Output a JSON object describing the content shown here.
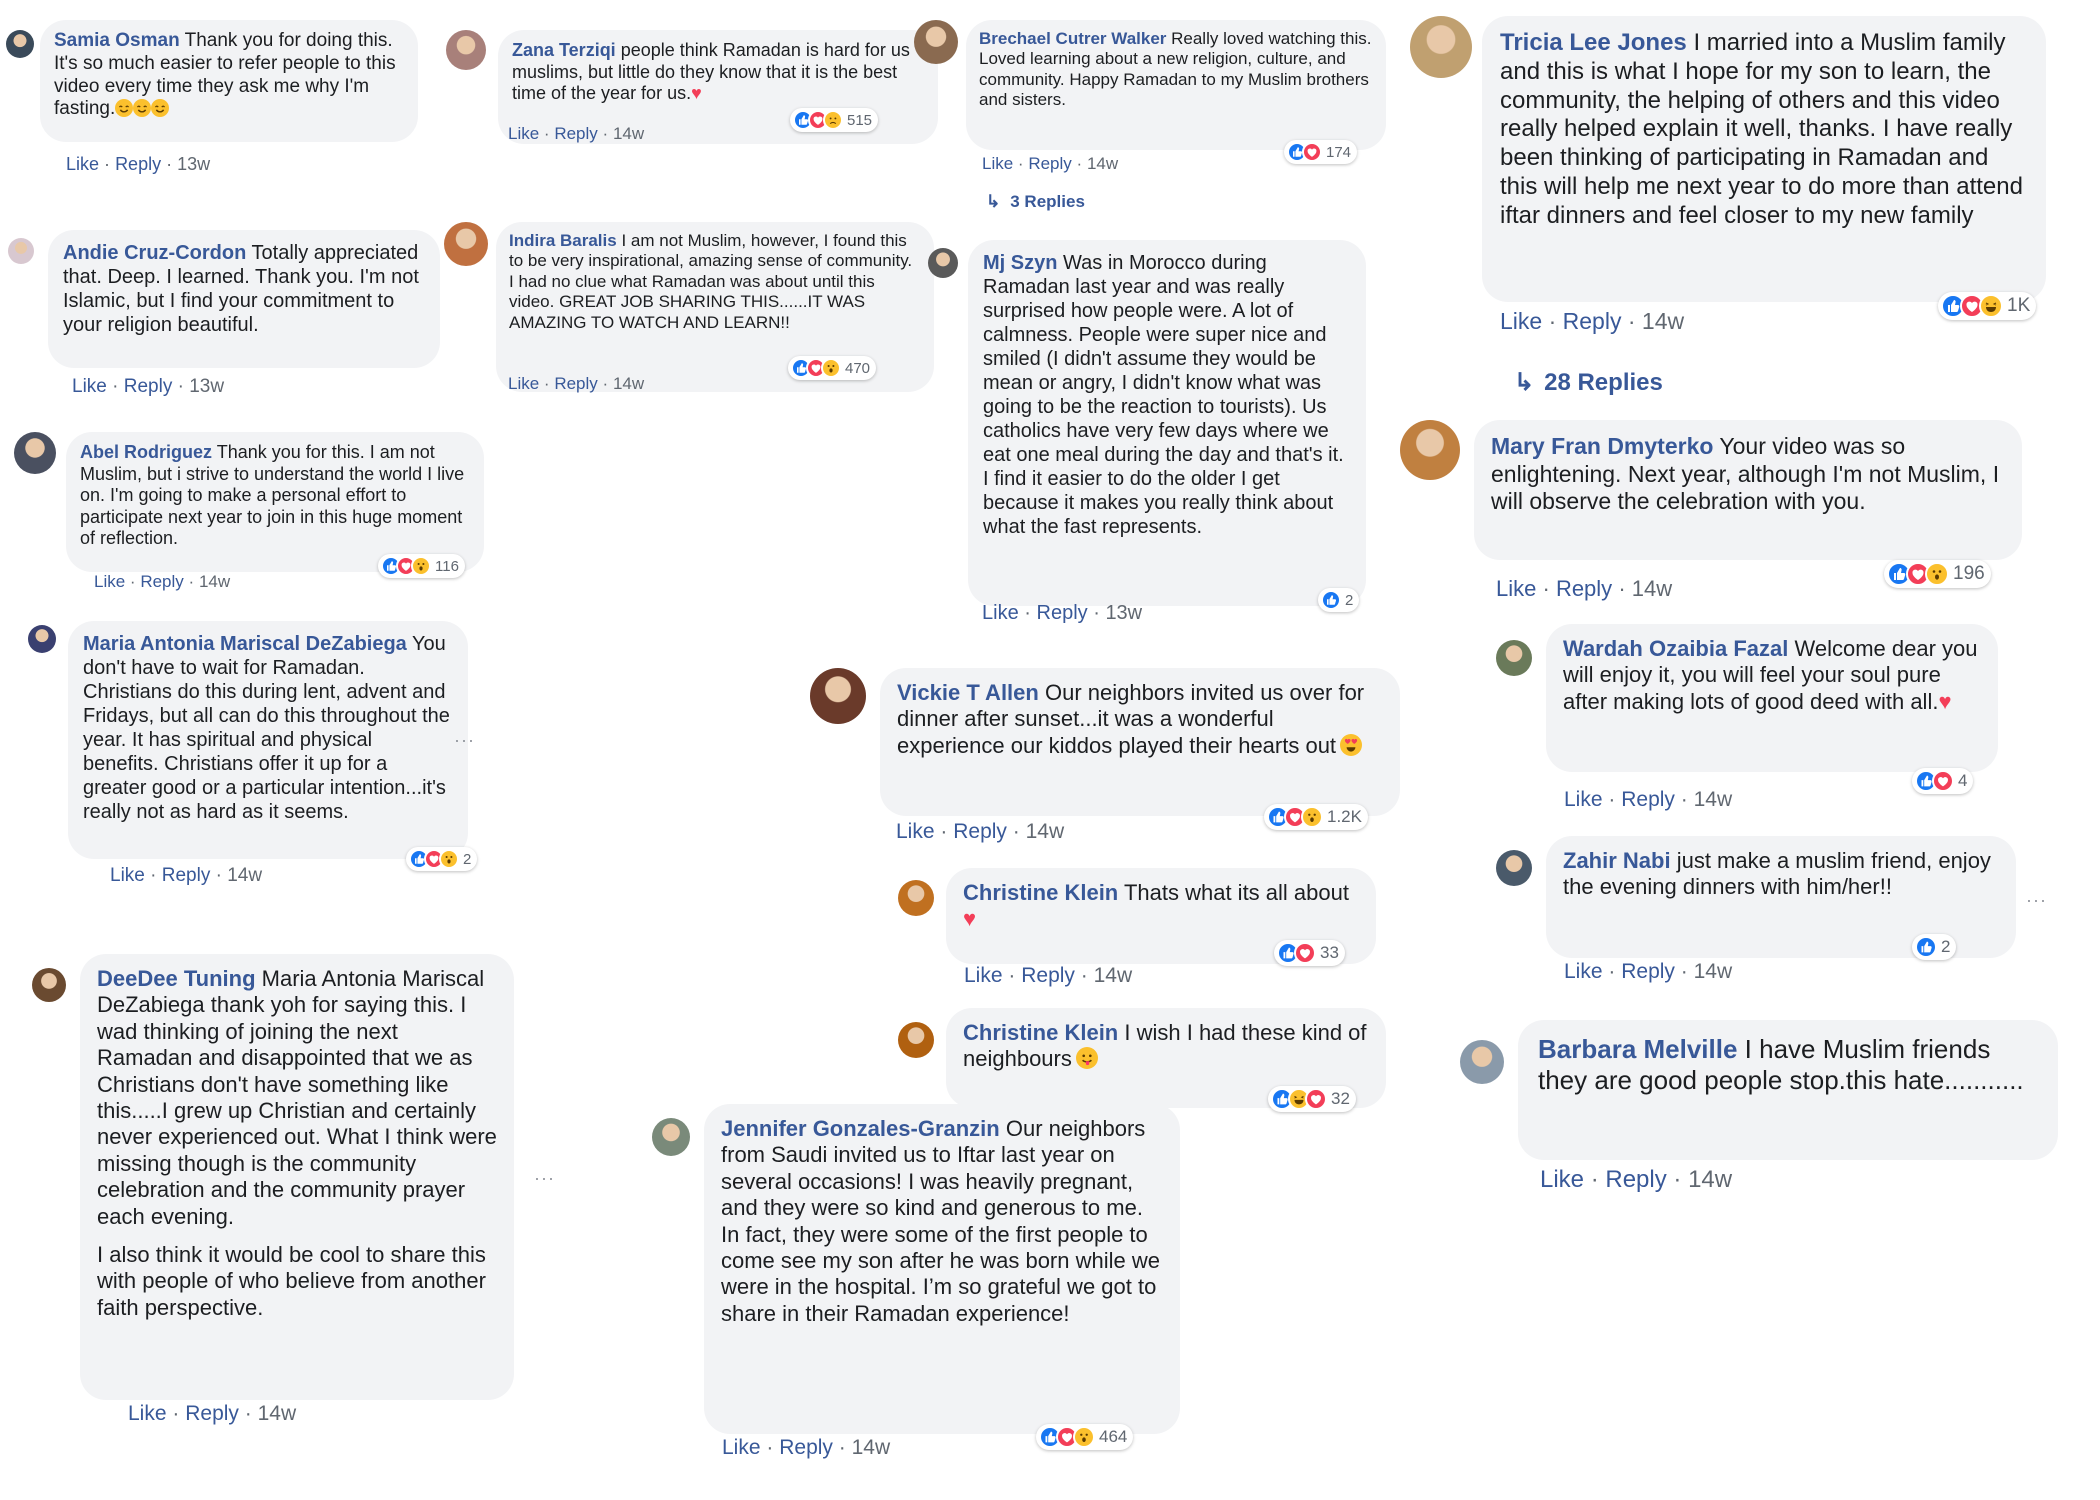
{
  "actions": {
    "like": "Like",
    "reply": "Reply",
    "sep": "·"
  },
  "colors": {
    "link": "#385898",
    "bubble": "#f2f3f5",
    "like": "#1877f2",
    "love": "#f33e58",
    "wow": "#fbc02d"
  },
  "comments": [
    {
      "author": "Samia Osman",
      "text": "Thank you for doing this. It's so much easier to refer people to this video every time they ask me why I'm fasting.",
      "emoji": "smile-emoji x3",
      "time": "13w"
    },
    {
      "author": "Andie Cruz-Cordon",
      "text": "Totally appreciated that. Deep. I learned. Thank you. I'm not Islamic, but I find your commitment to your religion beautiful.",
      "time": "13w"
    },
    {
      "author": "Abel Rodriguez",
      "text": "Thank you for this. I am not Muslim, but i strive to understand the world I live on. I'm going to make a personal effort to participate next year to join in this huge moment of reflection.",
      "time": "14w",
      "reactions": "116"
    },
    {
      "author": "Maria Antonia Mariscal DeZabiega",
      "text": "You don't have to wait for Ramadan. Christians do this during lent, advent and Fridays, but all can do this throughout the year. It has spiritual and physical benefits. Christians offer it up for a greater good or a particular intention...it's really not as hard as it seems.",
      "time": "14w",
      "reactions": "2"
    },
    {
      "author": "DeeDee Tuning",
      "text": "Maria Antonia Mariscal DeZabiega thank yoh for saying this. I wad thinking of joining the next Ramadan and disappointed that we as Christians don't have something like this.....I grew up Christian and certainly never experienced out. What I think were missing though is the community celebration and the community prayer each evening.",
      "text2": "I also think it would be cool to share this with people of who believe from another faith perspective.",
      "time": "14w"
    },
    {
      "author": "Zana Terziqi",
      "text": "people think Ramadan is hard for us muslims, but little do they know that it is the best time of the year for us.",
      "time": "14w",
      "reactions": "515"
    },
    {
      "author": "Indira Baralis",
      "text": "I am not Muslim, however, I found this to be very inspirational, amazing sense of community. I had no clue what Ramadan was about until this video. GREAT JOB SHARING THIS......IT WAS AMAZING TO WATCH AND LEARN!!",
      "time": "14w",
      "reactions": "470"
    },
    {
      "author": "Brechael Cutrer Walker",
      "text": "Really loved watching this. Loved learning about a new religion, culture, and community. Happy Ramadan to my Muslim brothers and sisters.",
      "time": "14w",
      "reactions": "174",
      "replies": "3 Replies"
    },
    {
      "author": "Mj Szyn",
      "text": "Was in Morocco during Ramadan last year and was really surprised how people were. A lot of calmness. People were super nice and smiled (I didn't assume they would be mean or angry, I didn't know what was going to be the reaction to tourists). Us catholics have very few days where we eat one meal during the day and that's it. I find it easier to do the older I get because it makes you really think about what the fast represents.",
      "time": "13w",
      "reactions": "2"
    },
    {
      "author": "Vickie T Allen",
      "text": "Our neighbors invited us over for dinner after sunset...it was a wonderful experience our kiddos played their hearts out",
      "time": "14w",
      "reactions": "1.2K"
    },
    {
      "author": "Christine Klein",
      "text": "Thats what its all about",
      "time": "14w",
      "reactions": "33"
    },
    {
      "author": "Christine Klein",
      "text": "I wish I had these kind of neighbours",
      "time": "",
      "reactions": "32"
    },
    {
      "author": "Jennifer Gonzales-Granzin",
      "text": "Our neighbors from Saudi invited us to Iftar last year on several occasions! I was heavily pregnant, and they were so kind and generous to me. In fact, they were some of the first people to come see my son after he was born while we were in the hospital. I’m so grateful we got to share in their Ramadan experience!",
      "time": "14w",
      "reactions": "464"
    },
    {
      "author": "Tricia Lee Jones",
      "text": "I married into a Muslim family and this is what I hope for my son to learn, the community, the helping of others and this video really helped explain it well, thanks. I have really been thinking of participating in Ramadan and this will help me next year to do more than attend iftar dinners and feel closer to my new family",
      "time": "14w",
      "reactions": "1K",
      "replies": "28 Replies"
    },
    {
      "author": "Mary Fran Dmyterko",
      "text": "Your video was so enlightening. Next year, although I'm not Muslim, I will observe the celebration with you.",
      "time": "14w",
      "reactions": "196"
    },
    {
      "author": "Wardah Ozaibia Fazal",
      "text": "Welcome dear you will enjoy it, you will feel your soul pure after making lots of good deed with all.",
      "time": "14w",
      "reactions": "4"
    },
    {
      "author": "Zahir Nabi",
      "text": "just make a muslim friend, enjoy the evening dinners with him/her!!",
      "time": "14w",
      "reactions": "2"
    },
    {
      "author": "Barbara Melville",
      "text": "I have Muslim friends they are good people stop.this hate...........",
      "time": "14w"
    }
  ]
}
